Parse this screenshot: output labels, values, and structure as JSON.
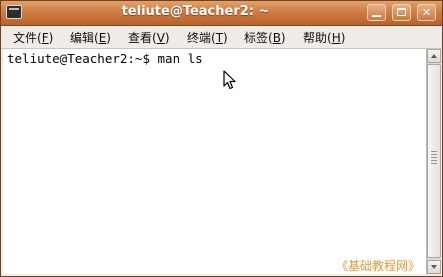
{
  "window": {
    "title": "teliute@Teacher2: ~",
    "app_icon": "terminal-icon",
    "buttons": {
      "minimize_icon": "minimize-icon",
      "maximize_icon": "maximize-icon",
      "close_label": "✕"
    }
  },
  "menu": {
    "items": [
      {
        "label": "文件(",
        "key": "F",
        "suffix": ")"
      },
      {
        "label": "编辑(",
        "key": "E",
        "suffix": ")"
      },
      {
        "label": "查看(",
        "key": "V",
        "suffix": ")"
      },
      {
        "label": "终端(",
        "key": "T",
        "suffix": ")"
      },
      {
        "label": "标签(",
        "key": "B",
        "suffix": ")"
      },
      {
        "label": "帮助(",
        "key": "H",
        "suffix": ")"
      }
    ]
  },
  "terminal": {
    "prompt": "teliute@Teacher2:~$ ",
    "command": "man ls"
  },
  "watermark": {
    "text": "《基础教程网》"
  },
  "colors": {
    "titlebar": "#cf7d44",
    "window_bg": "#efebe7",
    "terminal_bg": "#ffffff",
    "watermark": "#e39a36"
  }
}
